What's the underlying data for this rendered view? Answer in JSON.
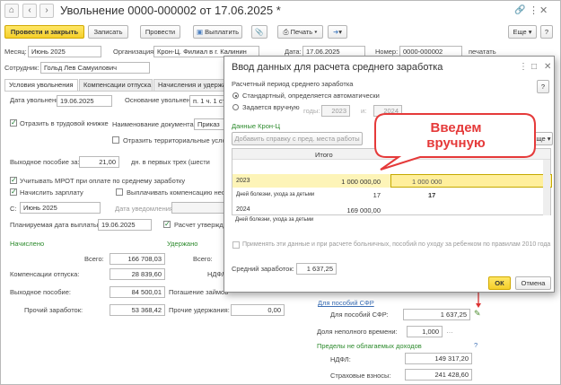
{
  "window": {
    "title": "Увольнение 0000-000002 от 17.06.2025 *"
  },
  "toolbar": {
    "post_close": "Провести и закрыть",
    "save": "Записать",
    "post": "Провести",
    "pay": "Выплатить",
    "print": "Печать",
    "more": "Еще",
    "help": "?"
  },
  "header": {
    "month_label": "Месяц:",
    "month_value": "Июнь 2025",
    "org_label": "Организация:",
    "org_value": "Крон-Ц. Филиал в г. Калинин",
    "date_label": "Дата:",
    "date_value": "17.06.2025",
    "number_label": "Номер:",
    "number_value": "0000-000002",
    "print_label": "печатать",
    "employee_label": "Сотрудник:",
    "employee_value": "Гольд Лев Самуилович"
  },
  "tabs": [
    "Условия увольнения",
    "Компенсации отпуска",
    "Начисления и удержа"
  ],
  "form": {
    "dismissal_date_label": "Дата увольнения:",
    "dismissal_date": "19.06.2025",
    "basis_label": "Основание увольнения:",
    "basis_value": "п. 1 ч. 1 ст",
    "workbook_chk": "Отразить в трудовой книжке",
    "doc_name_label": "Наименование документа:",
    "doc_name_value": "Приказ",
    "territorial_chk": "Отразить территориальные услови",
    "severance_label": "Выходное пособие за:",
    "severance_value": "21,00",
    "severance_unit": "дн. в первых трех (шести",
    "mrot_chk": "Учитывать МРОТ при оплате по среднему заработку",
    "accrue_chk": "Начислить зарплату",
    "pay_comp_chk": "Выплачивать компенсацию неот",
    "from_label": "С:",
    "from_value": "Июнь 2025",
    "notify_label": "Дата уведомления:",
    "planned_label": "Планируемая дата выплаты:",
    "planned_value": "19.06.2025",
    "calc_chk": "Расчет утвержд",
    "accrued_header": "Начислено",
    "withheld_header": "Удержано",
    "total_label": "Всего:",
    "total_value": "166 708,03",
    "withheld_total_label": "Всего:",
    "comp_label": "Компенсации отпуска:",
    "comp_value": "28 839,60",
    "ndfl_label": "НДФЛ:",
    "severance_pay_label": "Выходное пособие:",
    "severance_pay_value": "84 500,01",
    "loan_label": "Погашение займов",
    "other_label": "Прочий заработок:",
    "other_value": "53 368,42",
    "other_withheld_label": "Прочие удержания:",
    "other_withheld_value": "0,00"
  },
  "sfr": {
    "link": "Для пособий СФР",
    "label": "Для пособий СФР:",
    "value": "1 637,25",
    "parttime_label": "Доля неполного времени:",
    "parttime_value": "1,000",
    "limits_link": "Пределы не облагаемых доходов",
    "ndfl_label": "НДФЛ:",
    "ndfl_value": "149 317,20",
    "ins_label": "Страховые взносы:",
    "ins_value": "241 428,60",
    "q": "?"
  },
  "dialog": {
    "title": "Ввод данных для расчета среднего заработка",
    "period_label": "Расчетный период среднего заработка",
    "radio_auto": "Стандартный, определяется автоматически",
    "radio_manual": "Задается вручную",
    "years_label": "годы:",
    "year_from": "2023",
    "year_in": "и:",
    "year_to": "2024",
    "data_label": "Данные Крон-Ц",
    "add_ref": "Добавить справку с пред. места работы",
    "more": "Еще",
    "col_total": "Итого",
    "rows": [
      {
        "label": "2023",
        "total": "1 000 000,00",
        "entered": "1 000 000"
      },
      {
        "label": "Дней болезни, ухода за детьми",
        "total": "17",
        "entered": "17"
      },
      {
        "label": "2024",
        "total": "169 000,00",
        "entered": ""
      },
      {
        "label": "Дней болезни, ухода за детьми",
        "total": "",
        "entered": ""
      }
    ],
    "apply_chk": "Применять эти данные и при расчете больничных, пособий по уходу за ребенком по правилам 2010 года",
    "avg_label": "Средний заработок:",
    "avg_value": "1 637,25",
    "ok": "ОК",
    "cancel": "Отмена",
    "help": "?"
  },
  "callout": {
    "text": "Введем вручную"
  }
}
